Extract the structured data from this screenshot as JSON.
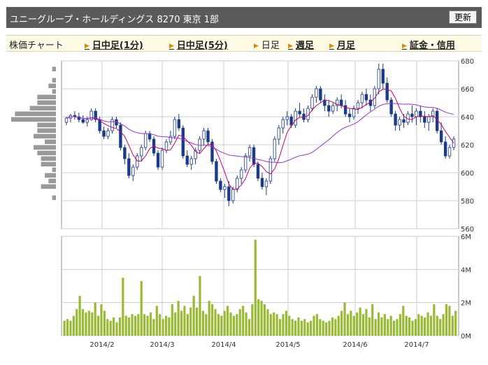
{
  "header": {
    "title": "ユニーグループ・ホールディングス 8270 東京 1部",
    "refresh_label": "更新"
  },
  "nav": {
    "items": [
      {
        "label": "株価チャート",
        "link": false
      },
      {
        "label": "日中足(1分)",
        "link": true
      },
      {
        "label": "日中足(5分)",
        "link": true
      },
      {
        "label": "日足",
        "link": false
      },
      {
        "label": "週足",
        "link": true
      },
      {
        "label": "月足",
        "link": true
      },
      {
        "label": "証金・信用",
        "link": true
      }
    ]
  },
  "colors": {
    "up_candle": "#ffffff",
    "down_candle": "#1a3a8a",
    "ma_short": "#c8006e",
    "ma_long": "#9933cc",
    "volume_bar": "#99bb33",
    "volume_profile": "#999999",
    "grid": "#cccccc"
  },
  "chart_data": [
    {
      "type": "candlestick",
      "yticks": [
        560,
        580,
        600,
        620,
        640,
        660,
        680
      ],
      "ylim": [
        560,
        680
      ],
      "xticks": [
        "2014/2",
        "2014/3",
        "2014/4",
        "2014/5",
        "2014/6",
        "2014/7"
      ],
      "series": [
        {
          "values": [
            [
              636,
              640,
              634,
              639
            ],
            [
              639,
              642,
              636,
              641
            ],
            [
              641,
              644,
              638,
              640
            ],
            [
              640,
              643,
              636,
              638
            ],
            [
              638,
              641,
              635,
              636
            ],
            [
              636,
              640,
              633,
              638
            ],
            [
              638,
              646,
              637,
              644
            ],
            [
              644,
              646,
              636,
              638
            ],
            [
              638,
              640,
              628,
              630
            ],
            [
              630,
              633,
              624,
              626
            ],
            [
              626,
              632,
              624,
              630
            ],
            [
              630,
              640,
              628,
              638
            ],
            [
              638,
              640,
              632,
              634
            ],
            [
              634,
              636,
              616,
              618
            ],
            [
              618,
              620,
              606,
              610
            ],
            [
              610,
              614,
              596,
              598
            ],
            [
              598,
              606,
              594,
              604
            ],
            [
              604,
              614,
              602,
              612
            ],
            [
              612,
              620,
              608,
              618
            ],
            [
              618,
              630,
              616,
              628
            ],
            [
              628,
              630,
              622,
              624
            ],
            [
              624,
              626,
              612,
              614
            ],
            [
              614,
              616,
              602,
              604
            ],
            [
              604,
              618,
              602,
              616
            ],
            [
              616,
              624,
              614,
              622
            ],
            [
              622,
              630,
              620,
              626
            ],
            [
              626,
              640,
              624,
              638
            ],
            [
              638,
              642,
              630,
              632
            ],
            [
              632,
              634,
              610,
              612
            ],
            [
              612,
              616,
              604,
              606
            ],
            [
              606,
              612,
              602,
              610
            ],
            [
              610,
              618,
              606,
              616
            ],
            [
              616,
              626,
              614,
              624
            ],
            [
              624,
              632,
              620,
              630
            ],
            [
              630,
              632,
              620,
              622
            ],
            [
              622,
              624,
              606,
              608
            ],
            [
              608,
              610,
              592,
              594
            ],
            [
              594,
              596,
              586,
              588
            ],
            [
              588,
              592,
              582,
              590
            ],
            [
              590,
              594,
              576,
              580
            ],
            [
              580,
              590,
              578,
              588
            ],
            [
              588,
              598,
              586,
              596
            ],
            [
              596,
              604,
              592,
              602
            ],
            [
              602,
              614,
              600,
              612
            ],
            [
              612,
              620,
              608,
              618
            ],
            [
              618,
              620,
              604,
              606
            ],
            [
              606,
              608,
              594,
              596
            ],
            [
              596,
              600,
              588,
              590
            ],
            [
              590,
              596,
              584,
              594
            ],
            [
              594,
              612,
              592,
              610
            ],
            [
              610,
              626,
              608,
              624
            ],
            [
              624,
              634,
              620,
              632
            ],
            [
              632,
              640,
              628,
              638
            ],
            [
              638,
              644,
              634,
              640
            ],
            [
              640,
              642,
              632,
              634
            ],
            [
              634,
              646,
              632,
              644
            ],
            [
              644,
              650,
              640,
              642
            ],
            [
              642,
              646,
              636,
              638
            ],
            [
              638,
              648,
              636,
              646
            ],
            [
              646,
              656,
              644,
              654
            ],
            [
              654,
              662,
              650,
              660
            ],
            [
              660,
              662,
              650,
              652
            ],
            [
              652,
              656,
              644,
              648
            ],
            [
              648,
              652,
              640,
              644
            ],
            [
              644,
              650,
              642,
              648
            ],
            [
              648,
              654,
              644,
              652
            ],
            [
              652,
              656,
              646,
              648
            ],
            [
              648,
              652,
              640,
              642
            ],
            [
              642,
              646,
              636,
              640
            ],
            [
              640,
              648,
              638,
              646
            ],
            [
              646,
              652,
              642,
              650
            ],
            [
              650,
              658,
              646,
              656
            ],
            [
              656,
              660,
              648,
              652
            ],
            [
              652,
              656,
              644,
              648
            ],
            [
              648,
              662,
              646,
              660
            ],
            [
              660,
              678,
              656,
              674
            ],
            [
              674,
              678,
              660,
              664
            ],
            [
              664,
              668,
              650,
              652
            ],
            [
              652,
              654,
              640,
              642
            ],
            [
              642,
              644,
              630,
              634
            ],
            [
              634,
              640,
              630,
              638
            ],
            [
              638,
              642,
              632,
              636
            ],
            [
              636,
              644,
              634,
              642
            ],
            [
              642,
              648,
              636,
              640
            ],
            [
              640,
              646,
              634,
              644
            ],
            [
              644,
              648,
              636,
              640
            ],
            [
              640,
              644,
              632,
              636
            ],
            [
              636,
              642,
              630,
              640
            ],
            [
              640,
              646,
              636,
              644
            ],
            [
              644,
              646,
              628,
              630
            ],
            [
              630,
              636,
              620,
              622
            ],
            [
              622,
              626,
              610,
              612
            ],
            [
              612,
              620,
              610,
              618
            ],
            [
              618,
              626,
              616,
              624
            ]
          ]
        }
      ]
    },
    {
      "type": "bar",
      "yticks": [
        "0M",
        "2M",
        "4M",
        "6M"
      ],
      "ylim": [
        0,
        6
      ],
      "series": [
        {
          "values": [
            0.9,
            1.0,
            0.9,
            1.2,
            1.6,
            2.4,
            1.6,
            1.4,
            1.5,
            1.4,
            2.0,
            1.2,
            1.9,
            1.5,
            1.0,
            0.9,
            1.1,
            0.8,
            1.1,
            3.5,
            1.2,
            1.1,
            1.3,
            1.2,
            1.3,
            3.3,
            1.3,
            1.2,
            1.4,
            1.0,
            1.8,
            1.3,
            1.0,
            1.2,
            1.1,
            1.9,
            1.4,
            2.1,
            1.5,
            1.8,
            1.3,
            1.7,
            2.4,
            1.7,
            3.6,
            1.5,
            1.3,
            2.1,
            1.9,
            1.6,
            1.3,
            1.2,
            1.5,
            1.8,
            1.4,
            1.2,
            1.3,
            1.6,
            1.8,
            1.4,
            1.0,
            1.9,
            5.8,
            2.2,
            2.1,
            1.9,
            1.6,
            1.3,
            1.4,
            1.3,
            1.0,
            1.3,
            1.5,
            1.2,
            1.0,
            0.9,
            1.1,
            0.9,
            1.0,
            0.8,
            0.9,
            1.2,
            1.3,
            1.0,
            0.9,
            0.8,
            0.9,
            1.1,
            1.0,
            1.2,
            1.5,
            2.0,
            1.3,
            1.5,
            1.2,
            1.4,
            1.7,
            1.3,
            1.6,
            1.1,
            1.9,
            1.0,
            1.4,
            1.1,
            1.3,
            1.0,
            1.2,
            0.9,
            1.0,
            1.3,
            1.8,
            1.2,
            1.1,
            0.9,
            1.0,
            1.3,
            1.2,
            1.1,
            1.4,
            1.2,
            1.9,
            1.2,
            1.0,
            1.3,
            1.9,
            1.8,
            1.2,
            1.5
          ]
        }
      ]
    }
  ]
}
